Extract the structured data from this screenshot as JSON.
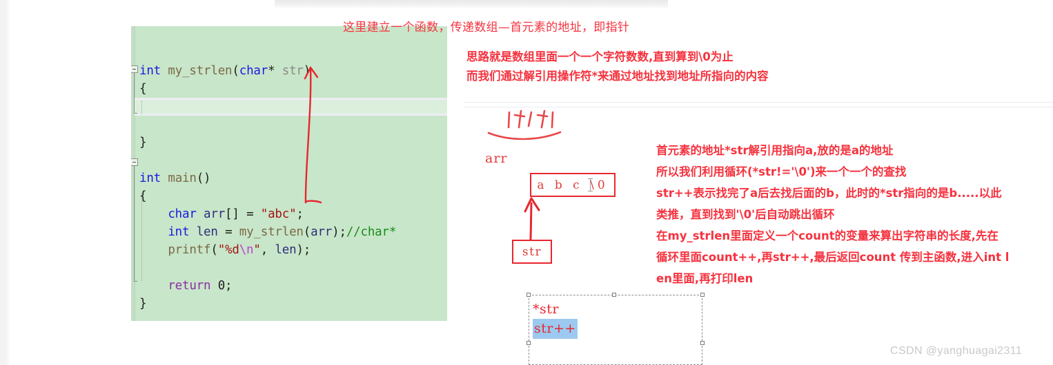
{
  "code": {
    "language": "C",
    "background_color": "#c8e6c9",
    "lines": [
      "int my_strlen(char* str)",
      "{",
      "",
      "}",
      "",
      "int main()",
      "{",
      "    char arr[] = \"abc\";",
      "    int len = my_strlen(arr);//char*",
      "    printf(\"%d\\n\", len);",
      "",
      "    return 0;",
      "}"
    ],
    "tokens": {
      "t_int": "int",
      "t_my_strlen": "my_strlen",
      "t_char": "char",
      "t_star": "*",
      "t_str_param": "str",
      "t_main": "main",
      "t_arr": "arr",
      "t_abc": "\"abc\"",
      "t_len": "len",
      "t_comment": "//char*",
      "t_printf": "printf",
      "t_fmt": "\"%d\\n\"",
      "t_return": "return",
      "t_zero": "0"
    }
  },
  "annotations": {
    "title": "这里建立一个函数，传递数组—首元素的地址，即指针",
    "idea": "思路就是数组里面一个一个字符数数,直到算到\\0为止\n而我们通过解引用操作符*来通过地址找到地址所指向的内容",
    "right_block": "首元素的地址*str解引用指向a,放的是a的地址\n所以我们利用循环(*str!='\\0')来一个一个的查找\nstr++表示找完了a后去找后面的b，此时的*str指向的是b.....以此\n类推，直到找到'\\0'后自动跳出循环\n在my_strlen里面定义一个count的变量来算出字符串的长度,先在\n循环里面count++,再str++,最后返回count 传到主函数,进入int l\nen里面,再打印len",
    "color": "#f5333f"
  },
  "diagram": {
    "array_label": "arr",
    "array_cells": "a  b  c  \\0",
    "pointer_box": "str",
    "scribble": "|ナ|ナ|",
    "stroke_color": "#e8262f"
  },
  "textbox": {
    "line1": "*str",
    "line2": "str++",
    "selection_color": "#9cc9ef",
    "border_style": "dashed"
  },
  "watermark": {
    "text": "CSDN @yanghuagai2311"
  }
}
